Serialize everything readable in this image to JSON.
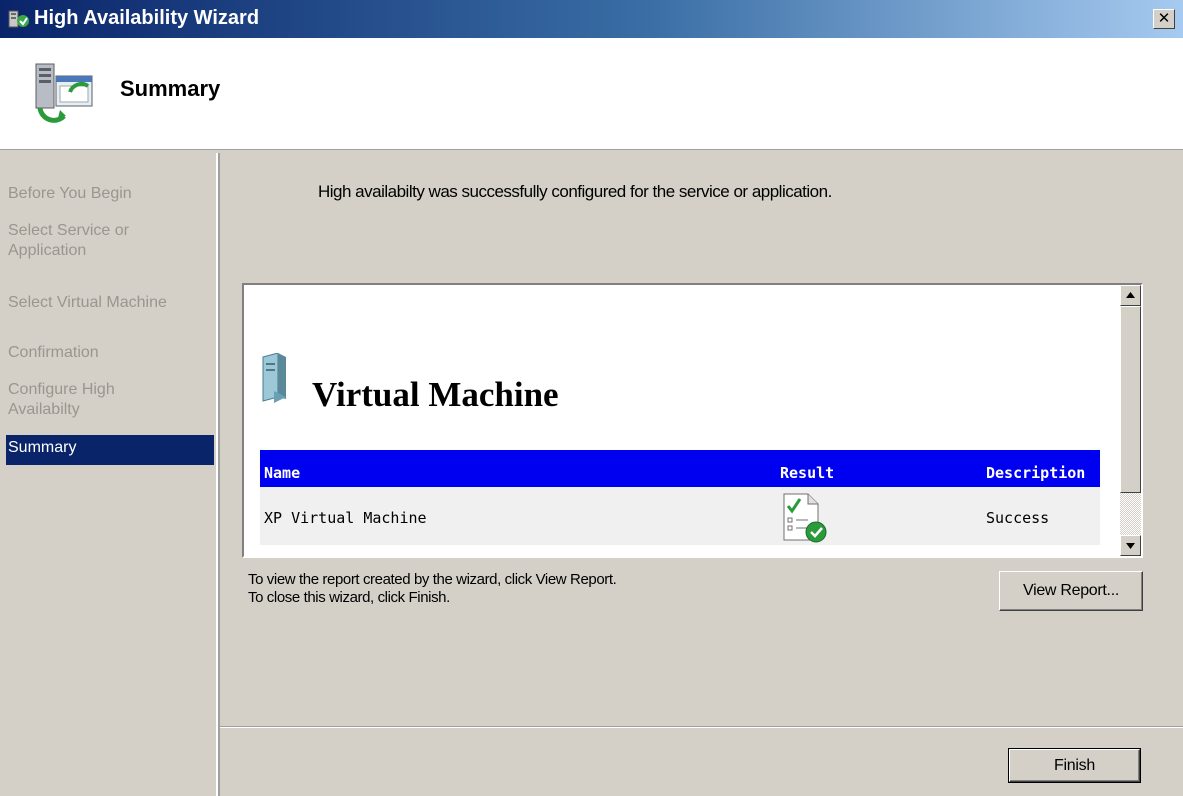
{
  "window": {
    "title": "High Availability Wizard",
    "close_glyph": "✕"
  },
  "header": {
    "title": "Summary",
    "icon": "wizard-server-icon"
  },
  "steps": [
    {
      "label": "Before You Begin",
      "active": false
    },
    {
      "label": "Select Service or Application",
      "active": false
    },
    {
      "label": "Select Virtual Machine",
      "active": false
    },
    {
      "label": "Confirmation",
      "active": false
    },
    {
      "label": "Configure High Availabilty",
      "active": false
    },
    {
      "label": "Summary",
      "active": true
    }
  ],
  "message": "High availabilty was successfully configured for the service or application.",
  "report": {
    "heading": "Virtual Machine",
    "columns": {
      "name": "Name",
      "result": "Result",
      "description": "Description"
    },
    "rows": [
      {
        "name": "XP Virtual Machine",
        "result_icon": "success-report-icon",
        "description": "Success"
      }
    ]
  },
  "hints": {
    "line1": "To view the report created by the wizard, click View Report.",
    "line2": "To close this wizard, click Finish."
  },
  "buttons": {
    "view_report": "View Report...",
    "finish": "Finish"
  },
  "colors": {
    "title_bar": "#0a246a",
    "active_step": "#0a246a",
    "table_header": "#0000f0",
    "dialog_bg": "#d4d0c8"
  }
}
